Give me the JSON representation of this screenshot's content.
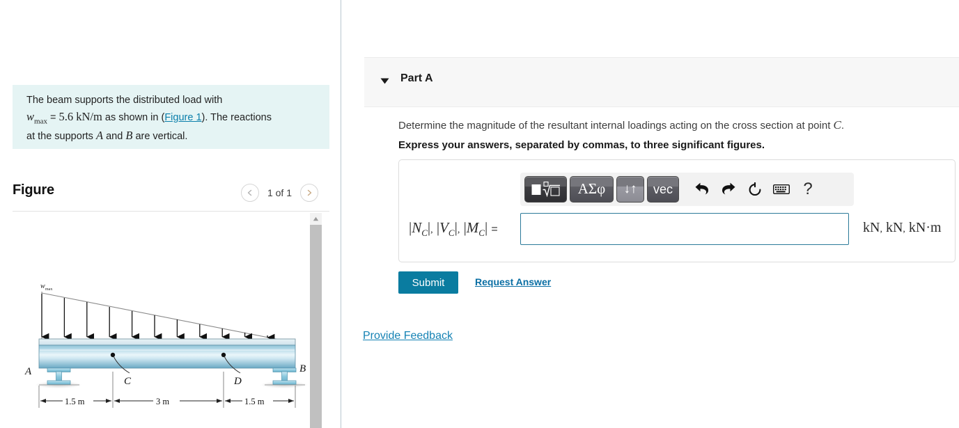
{
  "left": {
    "problem": {
      "line1_a": "The beam supports the distributed load with",
      "w_symbol": "w",
      "w_sub": "max",
      "equals": "=",
      "w_value": "5.6 kN/m",
      "line2_b": "as shown in (",
      "figure_link": "Figure 1",
      "line2_c": "). The reactions",
      "line3_a": "at the supports",
      "sym_A": "A",
      "and": "and",
      "sym_B": "B",
      "line3_b": "are vertical."
    },
    "figure": {
      "title": "Figure",
      "counter": "1 of 1",
      "prev_icon": "chevron-left-icon",
      "next_icon": "chevron-right-icon",
      "scroll_up_icon": "scroll-up-arrow-icon"
    },
    "beam_diagram": {
      "load_label": "w",
      "load_label_sub": "max",
      "point_A": "A",
      "point_B": "B",
      "point_C": "C",
      "point_D": "D",
      "dim_left": "1.5 m",
      "dim_mid": "3 m",
      "dim_right": "1.5 m"
    }
  },
  "right": {
    "part": {
      "caret_icon": "caret-down-icon",
      "label": "Part A"
    },
    "prompt_a": "Determine the magnitude of the resultant internal loadings acting on the cross section at point ",
    "prompt_point": "C",
    "prompt_period": ".",
    "instruction": "Express your answers, separated by commas, to three significant figures.",
    "toolbar": {
      "btn_template": "template-square-root-icon",
      "btn_greek": "ΑΣφ",
      "btn_updown": "↓↑",
      "btn_vec": "vec",
      "btn_undo": "undo-arrow-icon",
      "btn_redo": "redo-arrow-icon",
      "btn_reset": "reset-circular-arrow-icon",
      "btn_keyboard": "keyboard-icon",
      "btn_help": "?"
    },
    "answer": {
      "label_N": "N",
      "label_V": "V",
      "label_M": "M",
      "sub_C": "C",
      "equals": "=",
      "value": "",
      "placeholder": "",
      "units_kN": "kN",
      "units_kNm": "kN·m"
    },
    "submit_label": "Submit",
    "request_answer_label": "Request Answer",
    "provide_feedback_label": "Provide Feedback"
  },
  "colors": {
    "accent_teal": "#0a7ca0",
    "link_blue": "#1582b4",
    "problem_bg": "#e5f4f4",
    "input_border": "#2b7a99",
    "divider": "#b9c6d0"
  }
}
